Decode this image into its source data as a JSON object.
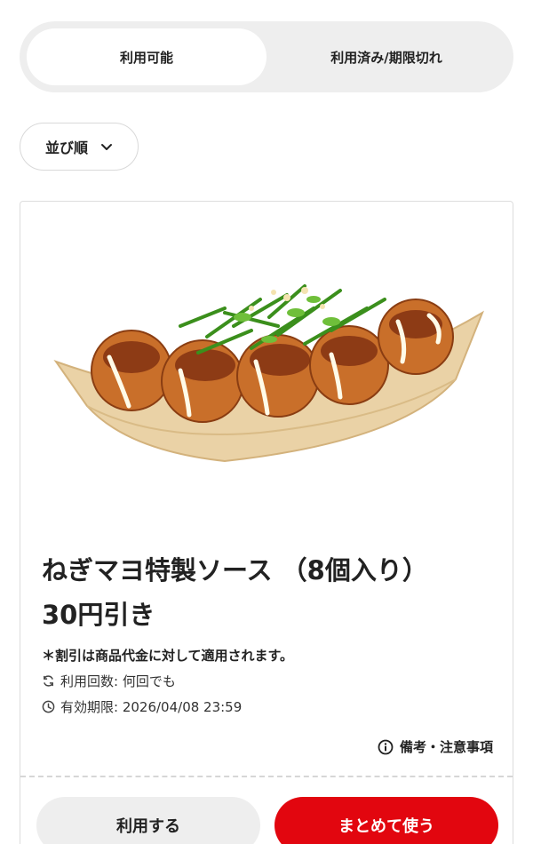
{
  "tabs": {
    "available": "利用可能",
    "used_expired": "利用済み/期限切れ"
  },
  "sort": {
    "label": "並び順"
  },
  "coupon": {
    "title_line1": "ねぎマヨ特製ソース （8個入り）",
    "title_line2": "30円引き",
    "note": "＊割引は商品代金に対して適用されます。",
    "usage": "利用回数: 何回でも",
    "expiry": "有効期限: 2026/04/08 23:59",
    "remarks": "備考・注意事項"
  },
  "buttons": {
    "use": "利用する",
    "combine": "まとめて使う"
  },
  "colors": {
    "accent": "#e2060f",
    "segment_bg": "#eeeeee"
  }
}
